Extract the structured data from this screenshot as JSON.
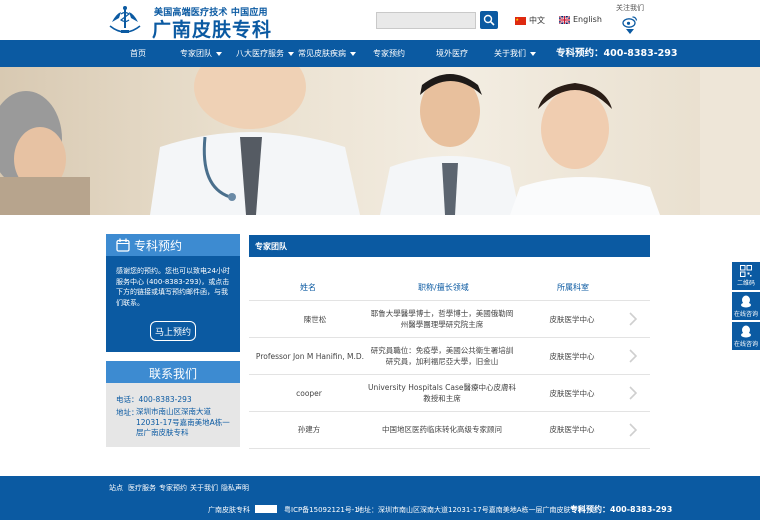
{
  "header": {
    "tagline": "美国高端医疗技术 中国应用",
    "brand": "广南皮肤专科",
    "search": {
      "placeholder": "",
      "value": ""
    },
    "languages": [
      {
        "label": "中文",
        "flag": "china"
      },
      {
        "label": "English",
        "flag": "uk"
      }
    ],
    "follow_label": "关注我们"
  },
  "nav": {
    "items": [
      {
        "label": "首页",
        "dropdown": false
      },
      {
        "label": "专家团队",
        "dropdown": true
      },
      {
        "label": "八大医疗服务",
        "dropdown": true
      },
      {
        "label": "常见皮肤疾病",
        "dropdown": true
      },
      {
        "label": "专家预约",
        "dropdown": false
      },
      {
        "label": "境外医疗",
        "dropdown": false
      },
      {
        "label": "关于我们",
        "dropdown": true
      }
    ],
    "hotline": "专科预约：400-8383-293"
  },
  "sidebar": {
    "appointment": {
      "title": "专科预约",
      "text": "感谢您的预约。您也可以致电24小时服务中心 (400-8383-293)，或点击下方的链接或填写预约邮件函，与我们联系。",
      "button": "马上预约"
    },
    "contact": {
      "title": "联系我们",
      "phone": "电话：400-8383-293",
      "address_label": "地址：",
      "address": "深圳市南山区深南大道12031-17号嘉南美地A栋一层广南皮肤专科"
    }
  },
  "main": {
    "section_title": "专家团队",
    "columns": [
      "姓名",
      "职称/擅长领域",
      "所属科室"
    ],
    "rows": [
      {
        "name": "陳世松",
        "title": "耶鲁大學醫學博士，哲學博士，美國俄勒岡州醫學團理學研究院主席",
        "dept": "皮肤医学中心"
      },
      {
        "name": "Professor Jon M Hanifin, M.D.",
        "title": "研究員職位：免疫學，美國公共衛生署培訓研究員，加利福尼亞大學，旧金山",
        "dept": "皮肤医学中心"
      },
      {
        "name": "cooper",
        "title": "University Hospitals Case醫療中心皮膚科教授和主席",
        "dept": "皮肤医学中心"
      },
      {
        "name": "孙建方",
        "title": "中国地区医药临床转化高级专家顾问",
        "dept": "皮肤医学中心"
      }
    ]
  },
  "float_bar": {
    "items": [
      {
        "label": "二维码",
        "icon": "qr-code-icon"
      },
      {
        "label": "在线咨询",
        "icon": "qq-icon"
      },
      {
        "label": "在线咨询",
        "icon": "qq-icon"
      }
    ]
  },
  "footer": {
    "links": [
      "站点",
      "医疗服务",
      "专家预约",
      "关于我们",
      "隐私声明"
    ],
    "brand": "广南皮肤专科",
    "icp": "粤ICP备15092121号-1",
    "address": "地址：深圳市南山区深南大道12031-17号嘉南美地A栋一层广南皮肤专科",
    "hotline": "专科预约：400-8383-293"
  },
  "colors": {
    "primary": "#0b5aa2",
    "accent": "#3d8bd1",
    "panel": "#e6e6e6"
  }
}
